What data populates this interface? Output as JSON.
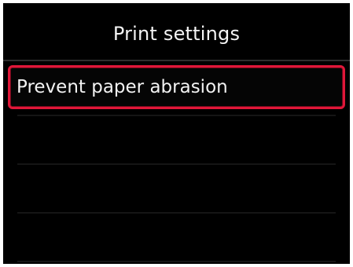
{
  "screen": {
    "title": "Print settings"
  },
  "menu": {
    "items": [
      {
        "label": "Prevent paper abrasion"
      }
    ]
  },
  "colors": {
    "background": "#000000",
    "text": "#f2f2f2",
    "selection": "#e01739"
  }
}
